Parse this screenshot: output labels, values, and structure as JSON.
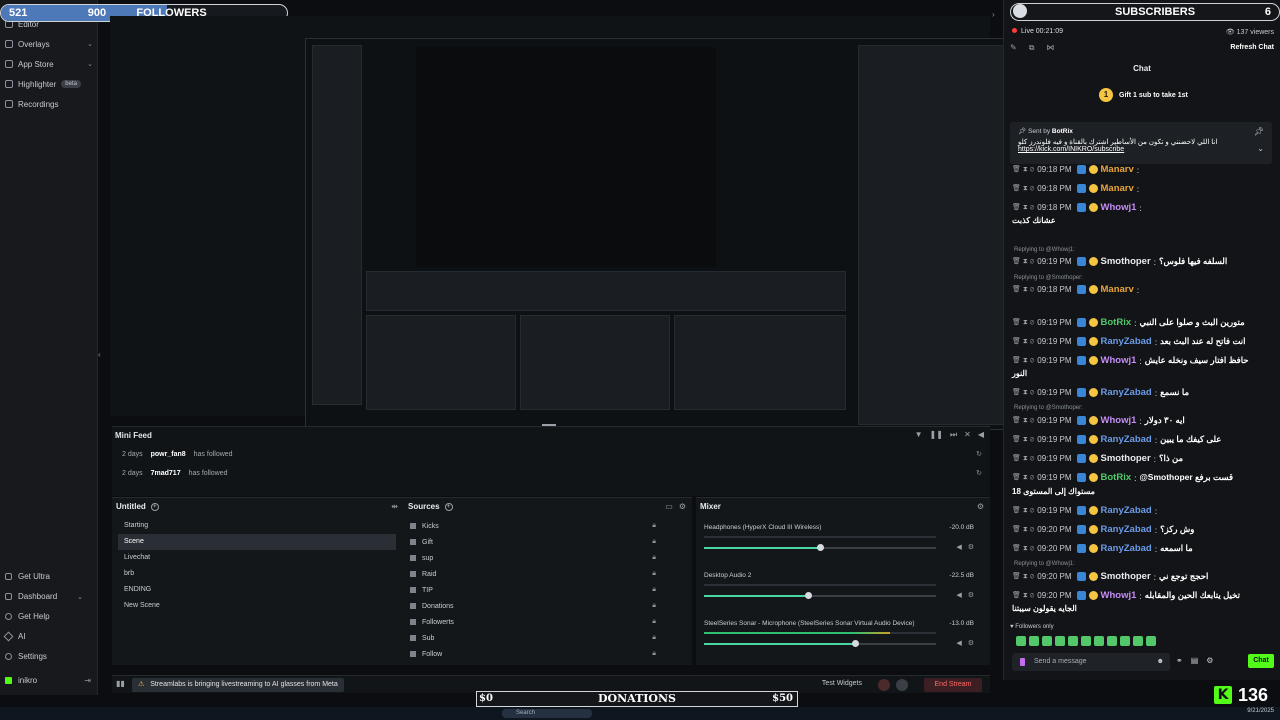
{
  "followers_goal": {
    "label": "FOLLOWERS",
    "current": "521",
    "goal": "900",
    "progress": 0.579
  },
  "subscribers_goal": {
    "label": "SUBSCRIBERS",
    "goal": "6"
  },
  "sidebar": {
    "items": [
      {
        "label": "Editor",
        "icon": "editor-icon"
      },
      {
        "label": "Overlays",
        "icon": "overlays-icon"
      },
      {
        "label": "App Store",
        "icon": "app-store-icon"
      },
      {
        "label": "Highlighter",
        "icon": "highlighter-icon",
        "badge": "beta"
      },
      {
        "label": "Recordings",
        "icon": "recordings-icon"
      }
    ],
    "bottom_items": [
      {
        "label": "Get Ultra",
        "icon": "ultra-icon"
      },
      {
        "label": "Dashboard",
        "icon": "dashboard-icon"
      },
      {
        "label": "Get Help",
        "icon": "help-icon"
      },
      {
        "label": "AI",
        "icon": "ai-icon"
      },
      {
        "label": "Settings",
        "icon": "settings-icon"
      }
    ],
    "user": "inikro"
  },
  "mini_feed": {
    "title": "Mini Feed",
    "events": [
      {
        "age": "2 days",
        "user": "powr_fan8",
        "action": "has followed"
      },
      {
        "age": "2 days",
        "user": "7mad717",
        "action": "has followed"
      }
    ]
  },
  "scenes": {
    "title": "Untitled",
    "items": [
      "Starting",
      "Scene",
      "Livechat",
      "brb",
      "ENDING",
      "New Scene"
    ],
    "selected": "Scene"
  },
  "sources": {
    "title": "Sources",
    "items": [
      "Kicks",
      "Gift",
      "sup",
      "Raid",
      "TIP",
      "Donations",
      "Followerts",
      "Sub",
      "Follow"
    ]
  },
  "mixer": {
    "title": "Mixer",
    "channels": [
      {
        "name": "Headphones (HyperX Cloud III Wireless)",
        "db": "-20.0 dB",
        "level": 0.0,
        "volume": 0.5
      },
      {
        "name": "Desktop Audio 2",
        "db": "-22.5 dB",
        "level": 0.0,
        "volume": 0.45
      },
      {
        "name": "SteelSeries Sonar - Microphone (SteelSeries Sonar Virtual Audio Device)",
        "db": "-13.0 dB",
        "level": 0.8,
        "volume": 0.65
      }
    ]
  },
  "statusbar": {
    "news": "Streamlabs is bringing livestreaming to AI glasses from Meta",
    "test_widgets": "Test Widgets",
    "end_stream": "End Stream"
  },
  "donations_goal": {
    "label": "DONATIONS",
    "current": "$0",
    "goal": "$50"
  },
  "kick_viewers": {
    "logo": "K",
    "count": "136"
  },
  "taskbar": {
    "search": "Search",
    "date": "9/21/2025"
  },
  "chat": {
    "live": "Live 00:21:09",
    "viewers": "137 viewers",
    "refresh": "Refresh Chat",
    "title": "Chat",
    "gift_banner": "Gift 1 sub to take 1st",
    "pinned": {
      "sent_by_label": "Sent by",
      "sent_by": "BotRix",
      "text": "انا اللي لاحضنني و تكون من الأساطير اشترك بالقناة و فيه فلوندرز كلو",
      "link": "https://kick.com/INIKRO/subscribe"
    },
    "messages": [
      {
        "time": "09:18 PM",
        "user": "Manarv",
        "text": "",
        "color": "#e8a43a"
      },
      {
        "time": "09:18 PM",
        "user": "Manarv",
        "text": "",
        "color": "#e8a43a"
      },
      {
        "time": "09:18 PM",
        "user": "Whowj1",
        "text": "",
        "color": "#c58df5"
      },
      {
        "time": "09:19 PM",
        "user": "Smothoper",
        "text": "السلفه فيها فلوس؟",
        "color": "#e8ebee"
      },
      {
        "time": "09:18 PM",
        "user": "Manarv",
        "text": "",
        "color": "#e8a43a"
      },
      {
        "time": "09:19 PM",
        "user": "BotRix",
        "text": "متورين البث و صلوا على النبي",
        "color": "#53c86b"
      },
      {
        "time": "09:19 PM",
        "user": "RanyZabad",
        "text": "انت فاتح له عند البث بعد",
        "color": "#6c9be8"
      },
      {
        "time": "09:19 PM",
        "user": "Whowj1",
        "text": "حافظ افتار سيف ونخله عايش",
        "color": "#c58df5"
      },
      {
        "time": "09:19 PM",
        "user": "RanyZabad",
        "text": "ما نسمع",
        "color": "#6c9be8"
      },
      {
        "time": "09:19 PM",
        "user": "Whowj1",
        "text": "ايه ٣٠ دولار",
        "color": "#c58df5"
      },
      {
        "time": "09:19 PM",
        "user": "RanyZabad",
        "text": "على كيفك ما يبين",
        "color": "#6c9be8"
      },
      {
        "time": "09:19 PM",
        "user": "Smothoper",
        "text": "من ذا؟",
        "color": "#e8ebee"
      },
      {
        "time": "09:19 PM",
        "user": "BotRix",
        "text": "@Smothoper قست برفع",
        "color": "#53c86b"
      },
      {
        "time": "09:19 PM",
        "user": "RanyZabad",
        "text": "",
        "color": "#6c9be8"
      },
      {
        "time": "09:20 PM",
        "user": "RanyZabad",
        "text": "وش ركز؟",
        "color": "#6c9be8"
      },
      {
        "time": "09:20 PM",
        "user": "RanyZabad",
        "text": "ما اسمعه",
        "color": "#6c9be8"
      },
      {
        "time": "09:20 PM",
        "user": "Smothoper",
        "text": "احجج توجع ني",
        "color": "#e8ebee"
      },
      {
        "time": "09:20 PM",
        "user": "Whowj1",
        "text": "تخيل يتابعك الحين والمقابله",
        "color": "#c58df5"
      }
    ],
    "continuations": [
      "عشانك كذبت",
      "النور",
      "مستواك إلى المستوى 18",
      "الجايه يقولون سيبتنا"
    ],
    "replies": [
      "Replying to @Whowj1:",
      "Replying to @Smothoper:",
      "Replying to @Smothoper:",
      "Replying to @Whowj1:"
    ],
    "followers_only": "Followers only",
    "input_placeholder": "Send a message",
    "send": "Chat"
  }
}
